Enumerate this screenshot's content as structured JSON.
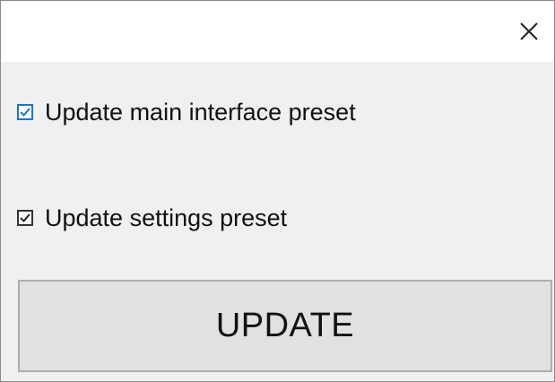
{
  "window": {
    "close_icon": "close-icon"
  },
  "options": [
    {
      "label": "Update main interface preset",
      "checked": true,
      "focused": true
    },
    {
      "label": "Update settings preset",
      "checked": true,
      "focused": false
    }
  ],
  "update_button": {
    "label": "UPDATE"
  },
  "colors": {
    "focus_accent": "#1f73c9",
    "button_face": "#e1e1e1",
    "window_bg": "#f0f0f0"
  }
}
